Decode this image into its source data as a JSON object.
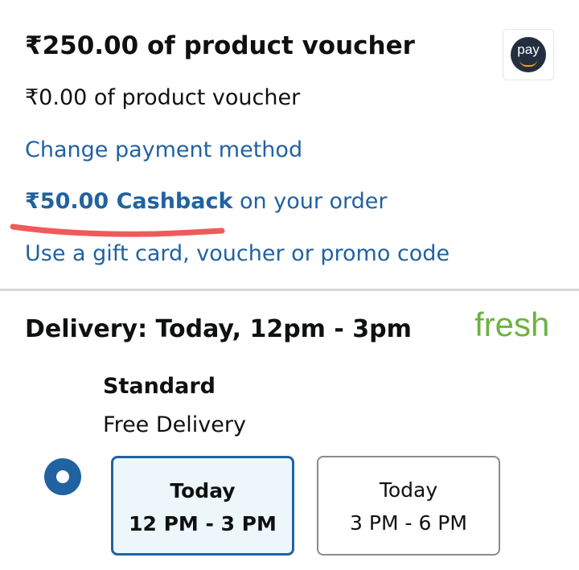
{
  "payment": {
    "voucher_title": "₹250.00 of product voucher",
    "voucher_sub": "₹0.00 of product voucher",
    "pay_badge_text": "pay",
    "change_payment": "Change payment method",
    "cashback_amount": "₹50.00 Cashback",
    "cashback_rest": " on your order",
    "gift_link": "Use a gift card, voucher or promo code"
  },
  "delivery": {
    "title": "Delivery: Today, 12pm - 3pm",
    "brand": "fresh",
    "option_name": "Standard",
    "option_desc": "Free Delivery",
    "slots": [
      {
        "day": "Today",
        "time": "12 PM - 3 PM",
        "selected": true
      },
      {
        "day": "Today",
        "time": "3 PM - 6 PM",
        "selected": false
      }
    ]
  },
  "colors": {
    "link": "#2162a1",
    "fresh_green": "#6cb33f",
    "annotation_red": "#f05a5a",
    "selected_slot_bg": "#edf6fb"
  }
}
